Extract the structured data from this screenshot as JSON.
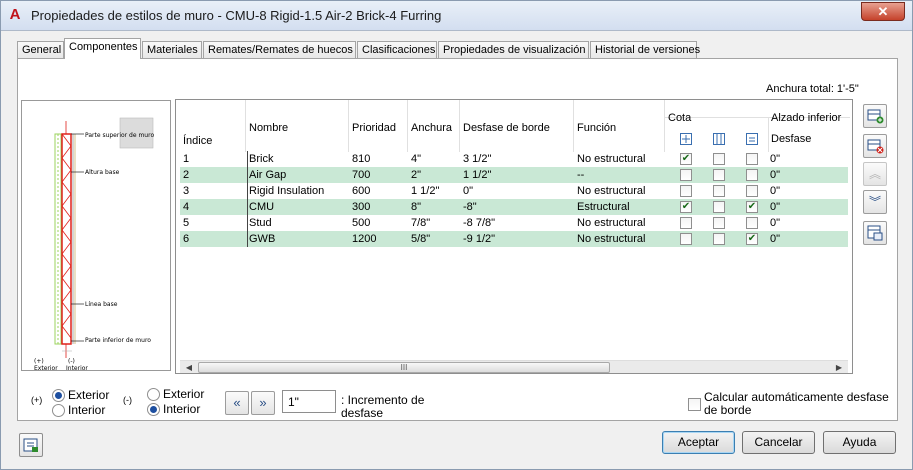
{
  "window": {
    "title": "Propiedades de estilos de muro - CMU-8 Rigid-1.5 Air-2 Brick-4 Furring",
    "close_label": "✕"
  },
  "tabs": [
    {
      "label": "General"
    },
    {
      "label": "Componentes"
    },
    {
      "label": "Materiales"
    },
    {
      "label": "Remates/Remates de huecos"
    },
    {
      "label": "Clasificaciones"
    },
    {
      "label": "Propiedades de visualización"
    },
    {
      "label": "Historial de versiones"
    }
  ],
  "active_tab": "Componentes",
  "total_width": "Anchura total: 1'-5\"",
  "preview": {
    "labels": [
      "Parte superior de muro",
      "Altura base",
      "Línea base",
      "Parte inferior de muro",
      "(+)",
      "Exterior",
      "(-)",
      "Interior"
    ]
  },
  "table": {
    "headers": {
      "index": "Índice",
      "name": "Nombre",
      "priority": "Prioridad",
      "width": "Anchura",
      "edge_offset": "Desfase de borde",
      "function": "Función",
      "dimension": "Cota",
      "bottom_elevation": "Alzado inferior",
      "offset": "Desfase"
    },
    "rows": [
      {
        "index": "1",
        "name": "Brick",
        "priority": "810",
        "width": "4\"",
        "edge_offset": "3 1/2\"",
        "function": "No estructural",
        "cota1": true,
        "cota2": false,
        "cota3": false,
        "offset": "0\""
      },
      {
        "index": "2",
        "name": "Air Gap",
        "priority": "700",
        "width": "2\"",
        "edge_offset": "1 1/2\"",
        "function": "--",
        "cota1": false,
        "cota2": false,
        "cota3": false,
        "offset": "0\""
      },
      {
        "index": "3",
        "name": "Rigid Insulation",
        "priority": "600",
        "width": "1 1/2\"",
        "edge_offset": "0\"",
        "function": "No estructural",
        "cota1": false,
        "cota2": false,
        "cota3": false,
        "offset": "0\""
      },
      {
        "index": "4",
        "name": "CMU",
        "priority": "300",
        "width": "8\"",
        "edge_offset": "-8\"",
        "function": "Estructural",
        "cota1": true,
        "cota2": false,
        "cota3": true,
        "offset": "0\""
      },
      {
        "index": "5",
        "name": "Stud",
        "priority": "500",
        "width": "7/8\"",
        "edge_offset": "-8 7/8\"",
        "function": "No estructural",
        "cota1": false,
        "cota2": false,
        "cota3": false,
        "offset": "0\""
      },
      {
        "index": "6",
        "name": "GWB",
        "priority": "1200",
        "width": "5/8\"",
        "edge_offset": "-9 1/2\"",
        "function": "No estructural",
        "cota1": false,
        "cota2": false,
        "cota3": true,
        "offset": "0\""
      }
    ],
    "scroll_thumb": "III"
  },
  "controls": {
    "plus_label": "(+)",
    "minus_label": "(-)",
    "exterior": "Exterior",
    "interior": "Interior",
    "plus_selected": "Exterior",
    "minus_selected": "Interior",
    "increment_value": "1\"",
    "increment_label_1": ": Incremento de",
    "increment_label_2": "desfase",
    "auto_offset_label_1": "Calcular automáticamente desfase",
    "auto_offset_label_2": "de borde",
    "auto_offset_checked": false
  },
  "buttons": {
    "ok": "Aceptar",
    "cancel": "Cancelar",
    "help": "Ayuda"
  }
}
